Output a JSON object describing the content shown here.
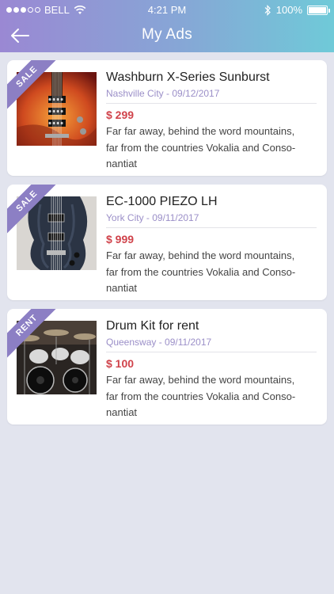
{
  "status": {
    "carrier": "BELL",
    "time": "4:21 PM",
    "battery": "100%"
  },
  "nav": {
    "title": "My Ads"
  },
  "ads": [
    {
      "badge": "SALE",
      "title": "Washburn X-Series Sunburst",
      "location_date": "Nashville City - 09/12/2017",
      "price": "$ 299",
      "desc_line1": "Far far away, behind the word mountains,",
      "desc_line2": "far from the countries Vokalia and Conso-",
      "desc_line3": "nantiat"
    },
    {
      "badge": "SALE",
      "title": "EC-1000 PIEZO LH",
      "location_date": "York City - 09/11/2017",
      "price": "$ 999",
      "desc_line1": "Far far away, behind the word mountains,",
      "desc_line2": "far from the countries Vokalia and Conso-",
      "desc_line3": "nantiat"
    },
    {
      "badge": "RENT",
      "title": "Drum Kit for rent",
      "location_date": "Queensway - 09/11/2017",
      "price": "$ 100",
      "desc_line1": "Far far away, behind the word mountains,",
      "desc_line2": "far from the countries Vokalia and Conso-",
      "desc_line3": "nantiat"
    }
  ],
  "colors": {
    "accent": "#8c7fc4",
    "price": "#d0434b",
    "meta": "#9b8fc8",
    "background": "#e2e4ee"
  },
  "icons": {
    "back": "arrow-left-icon",
    "wifi": "wifi-icon",
    "bluetooth": "bluetooth-icon",
    "battery": "battery-icon"
  }
}
